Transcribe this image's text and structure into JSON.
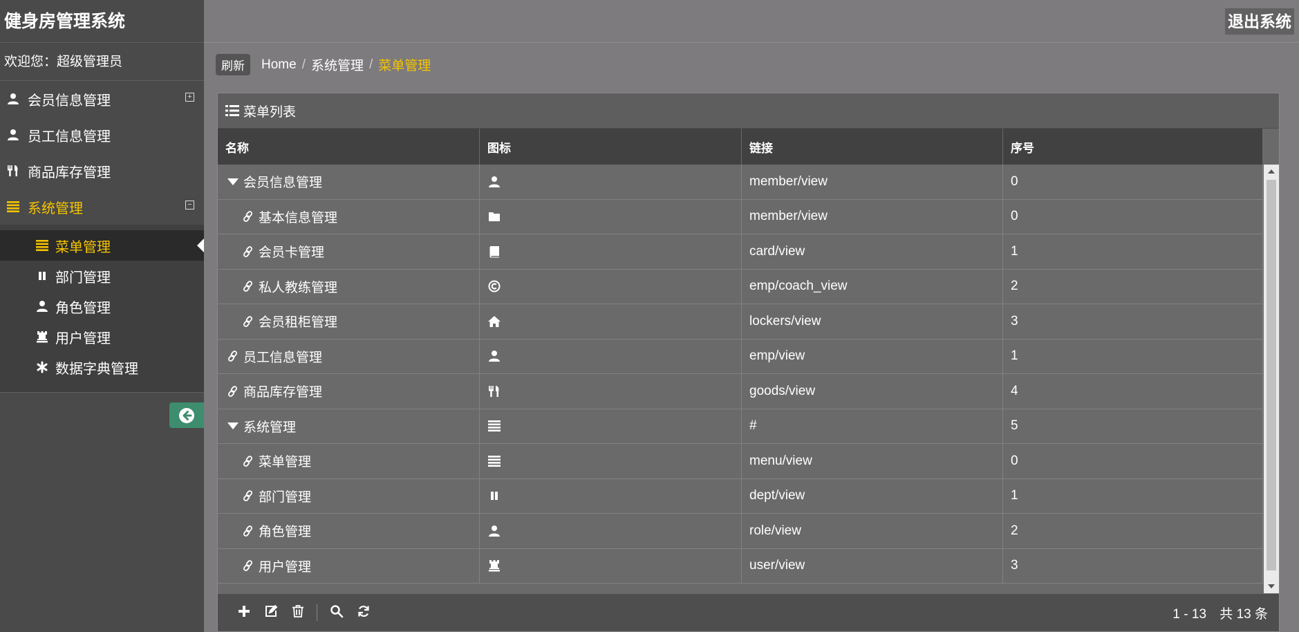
{
  "app": {
    "title": "健身房管理系统",
    "welcome": "欢迎您：超级管理员",
    "logout_label": "退出系统"
  },
  "sidebar": {
    "items": [
      {
        "label": "会员信息管理",
        "icon": "user-icon",
        "toggle": "+"
      },
      {
        "label": "员工信息管理",
        "icon": "user-icon"
      },
      {
        "label": "商品库存管理",
        "icon": "cutlery-icon"
      },
      {
        "label": "系统管理",
        "icon": "list-icon",
        "toggle": "−",
        "active": true
      }
    ],
    "sub_items": [
      {
        "label": "菜单管理",
        "icon": "list-icon",
        "active": true
      },
      {
        "label": "部门管理",
        "icon": "pause-icon"
      },
      {
        "label": "角色管理",
        "icon": "user-icon"
      },
      {
        "label": "用户管理",
        "icon": "tower-icon"
      },
      {
        "label": "数据字典管理",
        "icon": "asterisk-icon"
      }
    ]
  },
  "breadcrumb": {
    "refresh_label": "刷新",
    "items": [
      "Home",
      "系统管理",
      "菜单管理"
    ],
    "separator": "/"
  },
  "panel": {
    "title": "菜单列表"
  },
  "grid": {
    "columns": [
      "名称",
      "图标",
      "链接",
      "序号"
    ],
    "rows": [
      {
        "name": "会员信息管理",
        "level": 0,
        "expander": "open",
        "icon": "user-icon",
        "link": "member/view",
        "order": "0"
      },
      {
        "name": "基本信息管理",
        "level": 1,
        "expander": "leaf",
        "icon": "folder-icon",
        "link": "member/view",
        "order": "0"
      },
      {
        "name": "会员卡管理",
        "level": 1,
        "expander": "leaf",
        "icon": "book-icon",
        "link": "card/view",
        "order": "1"
      },
      {
        "name": "私人教练管理",
        "level": 1,
        "expander": "leaf",
        "icon": "copyright-icon",
        "link": "emp/coach_view",
        "order": "2"
      },
      {
        "name": "会员租柜管理",
        "level": 1,
        "expander": "leaf",
        "icon": "home-icon",
        "link": "lockers/view",
        "order": "3"
      },
      {
        "name": "员工信息管理",
        "level": 0,
        "expander": "leaf",
        "icon": "user-icon",
        "link": "emp/view",
        "order": "1"
      },
      {
        "name": "商品库存管理",
        "level": 0,
        "expander": "leaf",
        "icon": "cutlery-icon",
        "link": "goods/view",
        "order": "4"
      },
      {
        "name": "系统管理",
        "level": 0,
        "expander": "open",
        "icon": "list-icon",
        "link": "#",
        "order": "5"
      },
      {
        "name": "菜单管理",
        "level": 1,
        "expander": "leaf",
        "icon": "list-icon",
        "link": "menu/view",
        "order": "0"
      },
      {
        "name": "部门管理",
        "level": 1,
        "expander": "leaf",
        "icon": "pause-icon",
        "link": "dept/view",
        "order": "1"
      },
      {
        "name": "角色管理",
        "level": 1,
        "expander": "leaf",
        "icon": "user-icon",
        "link": "role/view",
        "order": "2"
      },
      {
        "name": "用户管理",
        "level": 1,
        "expander": "leaf",
        "icon": "tower-icon",
        "link": "user/view",
        "order": "3"
      }
    ]
  },
  "toolbar": {
    "buttons": [
      "add-icon",
      "edit-icon",
      "delete-icon",
      "search-icon",
      "refresh-icon"
    ]
  },
  "pager": {
    "range": "1 - 13",
    "total": "共 13 条"
  },
  "colors": {
    "accent": "#f5c400",
    "sidebar_bg": "#4a4a4a",
    "collapse_btn": "#3d8d6e"
  }
}
